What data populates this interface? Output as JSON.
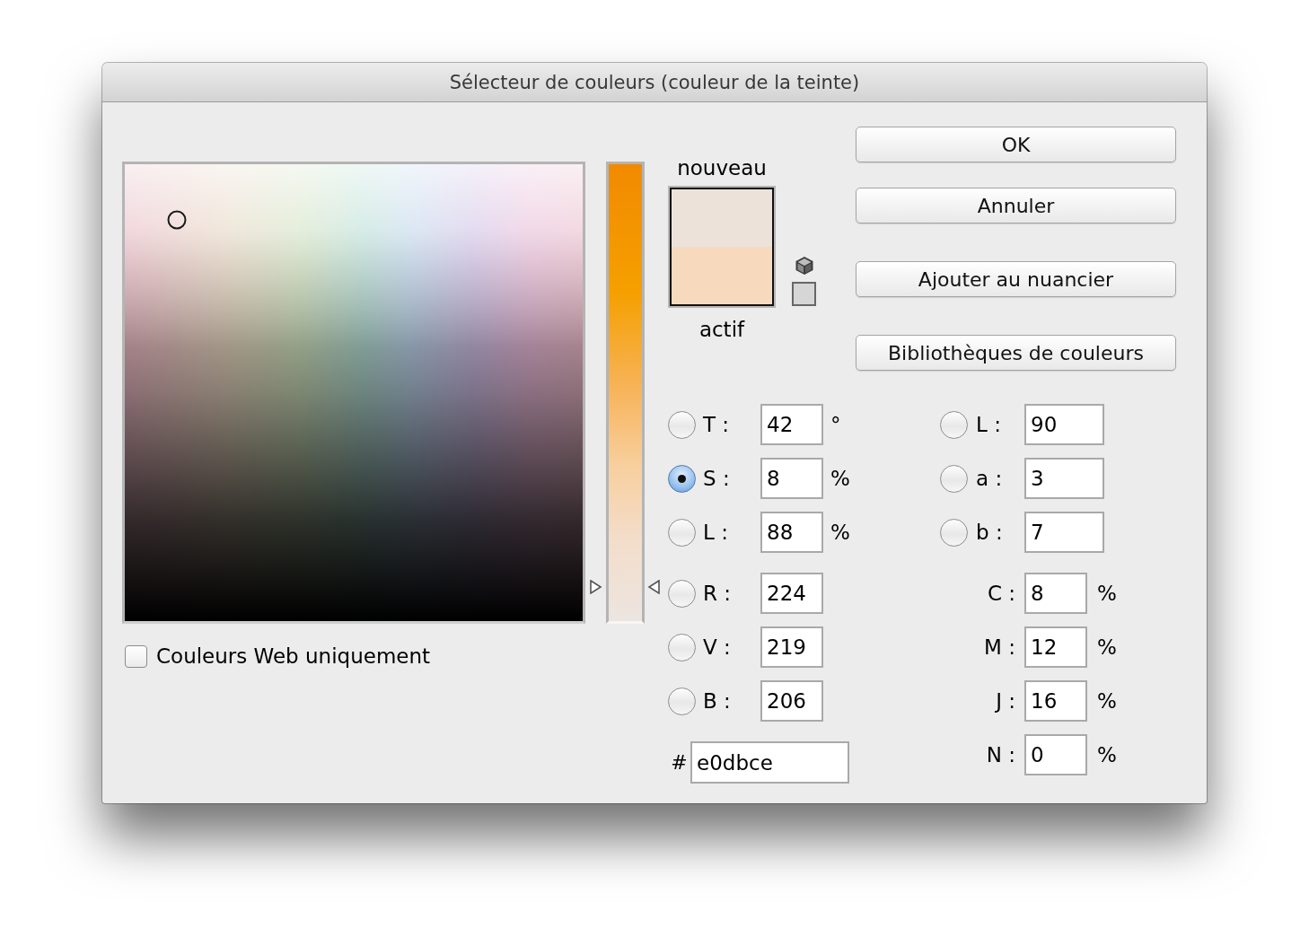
{
  "window": {
    "title": "Sélecteur de couleurs (couleur de la teinte)"
  },
  "slider": {
    "level": 0.08
  },
  "preview": [
    {
      "label": "nouveau",
      "color": "#ede2d9"
    },
    {
      "label": "actif",
      "color": "#f7dabe"
    }
  ],
  "buttons": [
    "OK",
    "Annuler",
    "Ajouter au nuancier",
    "Bibliothèques de couleurs"
  ],
  "hsb": [
    {
      "label": "T :",
      "value": "42",
      "unit": "°",
      "selected": false
    },
    {
      "label": "S :",
      "value": "8",
      "unit": "%",
      "selected": true
    },
    {
      "label": "L :",
      "value": "88",
      "unit": "%",
      "selected": false
    }
  ],
  "rgb": [
    {
      "label": "R :",
      "value": "224",
      "selected": false
    },
    {
      "label": "V :",
      "value": "219",
      "selected": false
    },
    {
      "label": "B :",
      "value": "206",
      "selected": false
    }
  ],
  "hex": {
    "label": "#",
    "value": "e0dbce"
  },
  "lab": [
    {
      "label": "L :",
      "value": "90",
      "selected": false
    },
    {
      "label": "a :",
      "value": "3",
      "selected": false
    },
    {
      "label": "b :",
      "value": "7",
      "selected": false
    }
  ],
  "cmyk": [
    {
      "label": "C :",
      "value": "8",
      "unit": "%"
    },
    {
      "label": "M :",
      "value": "12",
      "unit": "%"
    },
    {
      "label": "J :",
      "value": "16",
      "unit": "%"
    },
    {
      "label": "N :",
      "value": "0",
      "unit": "%"
    }
  ],
  "web_colors_only": {
    "label": "Couleurs Web uniquement",
    "checked": false
  }
}
